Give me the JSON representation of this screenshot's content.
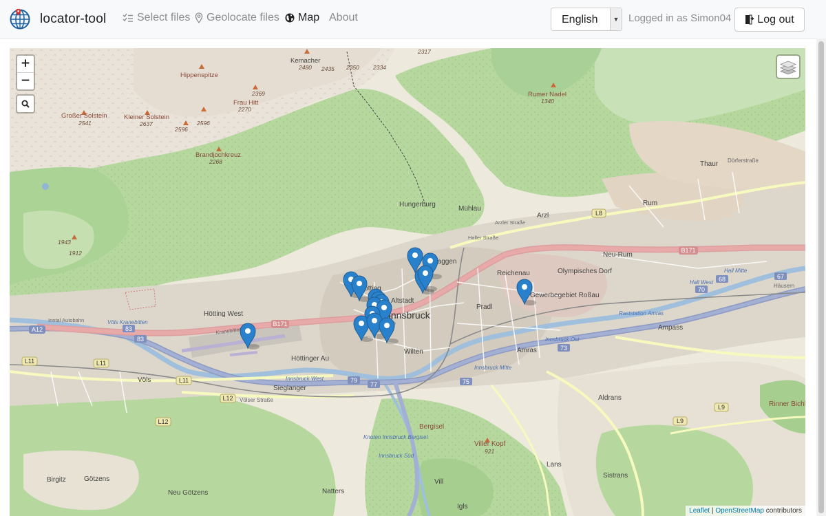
{
  "navbar": {
    "brand": "locator-tool",
    "links": [
      {
        "label": "Select files",
        "icon": "list-check-icon"
      },
      {
        "label": "Geolocate files",
        "icon": "map-pin-icon"
      },
      {
        "label": "Map",
        "icon": "globe-icon",
        "active": true
      },
      {
        "label": "About"
      }
    ],
    "language": "English",
    "logged_in_text": "Logged in as Simon04",
    "logout_label": "Log out"
  },
  "map": {
    "zoom_in": "+",
    "zoom_out": "−",
    "attribution": {
      "leaflet": "Leaflet",
      "separator": " | ",
      "osm": "OpenStreetMap",
      "suffix": " contributors"
    },
    "labels": {
      "kemacher": "Kemacher",
      "e2480": "2480",
      "e2435": "2435",
      "e2350": "2350",
      "e2334": "2334",
      "e2317": "2317",
      "hippenspitze": "Hippenspitze",
      "frau_hitt": "Frau Hitt",
      "e2369": "2369",
      "e2270": "2270",
      "gross_solstein": "Großer Solstein",
      "e2541": "2541",
      "klein_solstein": "Kleiner Solstein",
      "e2637": "2637",
      "e2596a": "2596",
      "e2596b": "2596",
      "brandjoch": "Brandjochkreuz",
      "e2268": "2268",
      "rumer_nadel": "Rumer Nadel",
      "e1340": "1340",
      "thaur": "Thaur",
      "dorferstrasse": "Dörferstraße",
      "rum": "Rum",
      "hungerburg": "Hungerburg",
      "muehlau": "Mühlau",
      "arzl": "Arzl",
      "arzler_strasse": "Arzler Straße",
      "haller_strasse": "Haller Straße",
      "neu_rum": "Neu-Rum",
      "olympisches_dorf": "Olympisches Dorf",
      "reichenau": "Reichenau",
      "gewerbe": "Gewerbegebiet Roßau",
      "hall_west": "Hall West",
      "hall_mitte": "Hall Mitte",
      "hausern": "Häusern",
      "e1943": "1943",
      "e1912": "1912",
      "hoetting": "Hötting",
      "hoetting_west": "Hötting West",
      "altstadt": "Altstadt",
      "innsbruck": "Innsbruck",
      "pradl": "Pradl",
      "saggen": "Saggen",
      "raststation": "Raststation Amras",
      "ampass": "Ampass",
      "innsbruck_ost": "Innsbruck Ost",
      "amras": "Amras",
      "voels_kranebitten": "Völs Kranebitten",
      "hoettinger_au": "Höttinger Au",
      "wilten": "Wilten",
      "innsbruck_mitte": "Innsbruck Mitte",
      "innsbruck_west": "Innsbruck West",
      "voels": "Völs",
      "sieglanger": "Sieglanger",
      "voelser_strasse": "Völser Straße",
      "aldrans": "Aldrans",
      "rinner_bichl": "Rinner Bichl",
      "bergisel": "Bergisel",
      "knoten": "Knoten Innsbruck Bergisel",
      "viller_kopf": "Viller Kopf",
      "e921": "921",
      "innsbruck_sued": "Innsbruck Süd",
      "lans": "Lans",
      "sistrans": "Sistrans",
      "birgitz": "Birgitz",
      "goetzens": "Götzens",
      "neu_goetzens": "Neu Götzens",
      "natters": "Natters",
      "vill": "Vill",
      "igls": "Igls",
      "kranebitter_allee": "Kranebitter Allee",
      "inntal_autobahn": "Inntal Autobahn",
      "a12": "A12",
      "b171a": "B171",
      "b171b": "B171",
      "l11a": "L11",
      "l11b": "L11",
      "l11c": "L11",
      "l12a": "L12",
      "l12b": "L12",
      "l8": "L8",
      "l9a": "L9",
      "l9b": "L9",
      "n83a": "83",
      "n83b": "83",
      "n79": "79",
      "n77": "77",
      "n75": "75",
      "n73": "73",
      "n70": "70",
      "n68": "68",
      "n67": "67"
    },
    "marker_count": 17
  }
}
